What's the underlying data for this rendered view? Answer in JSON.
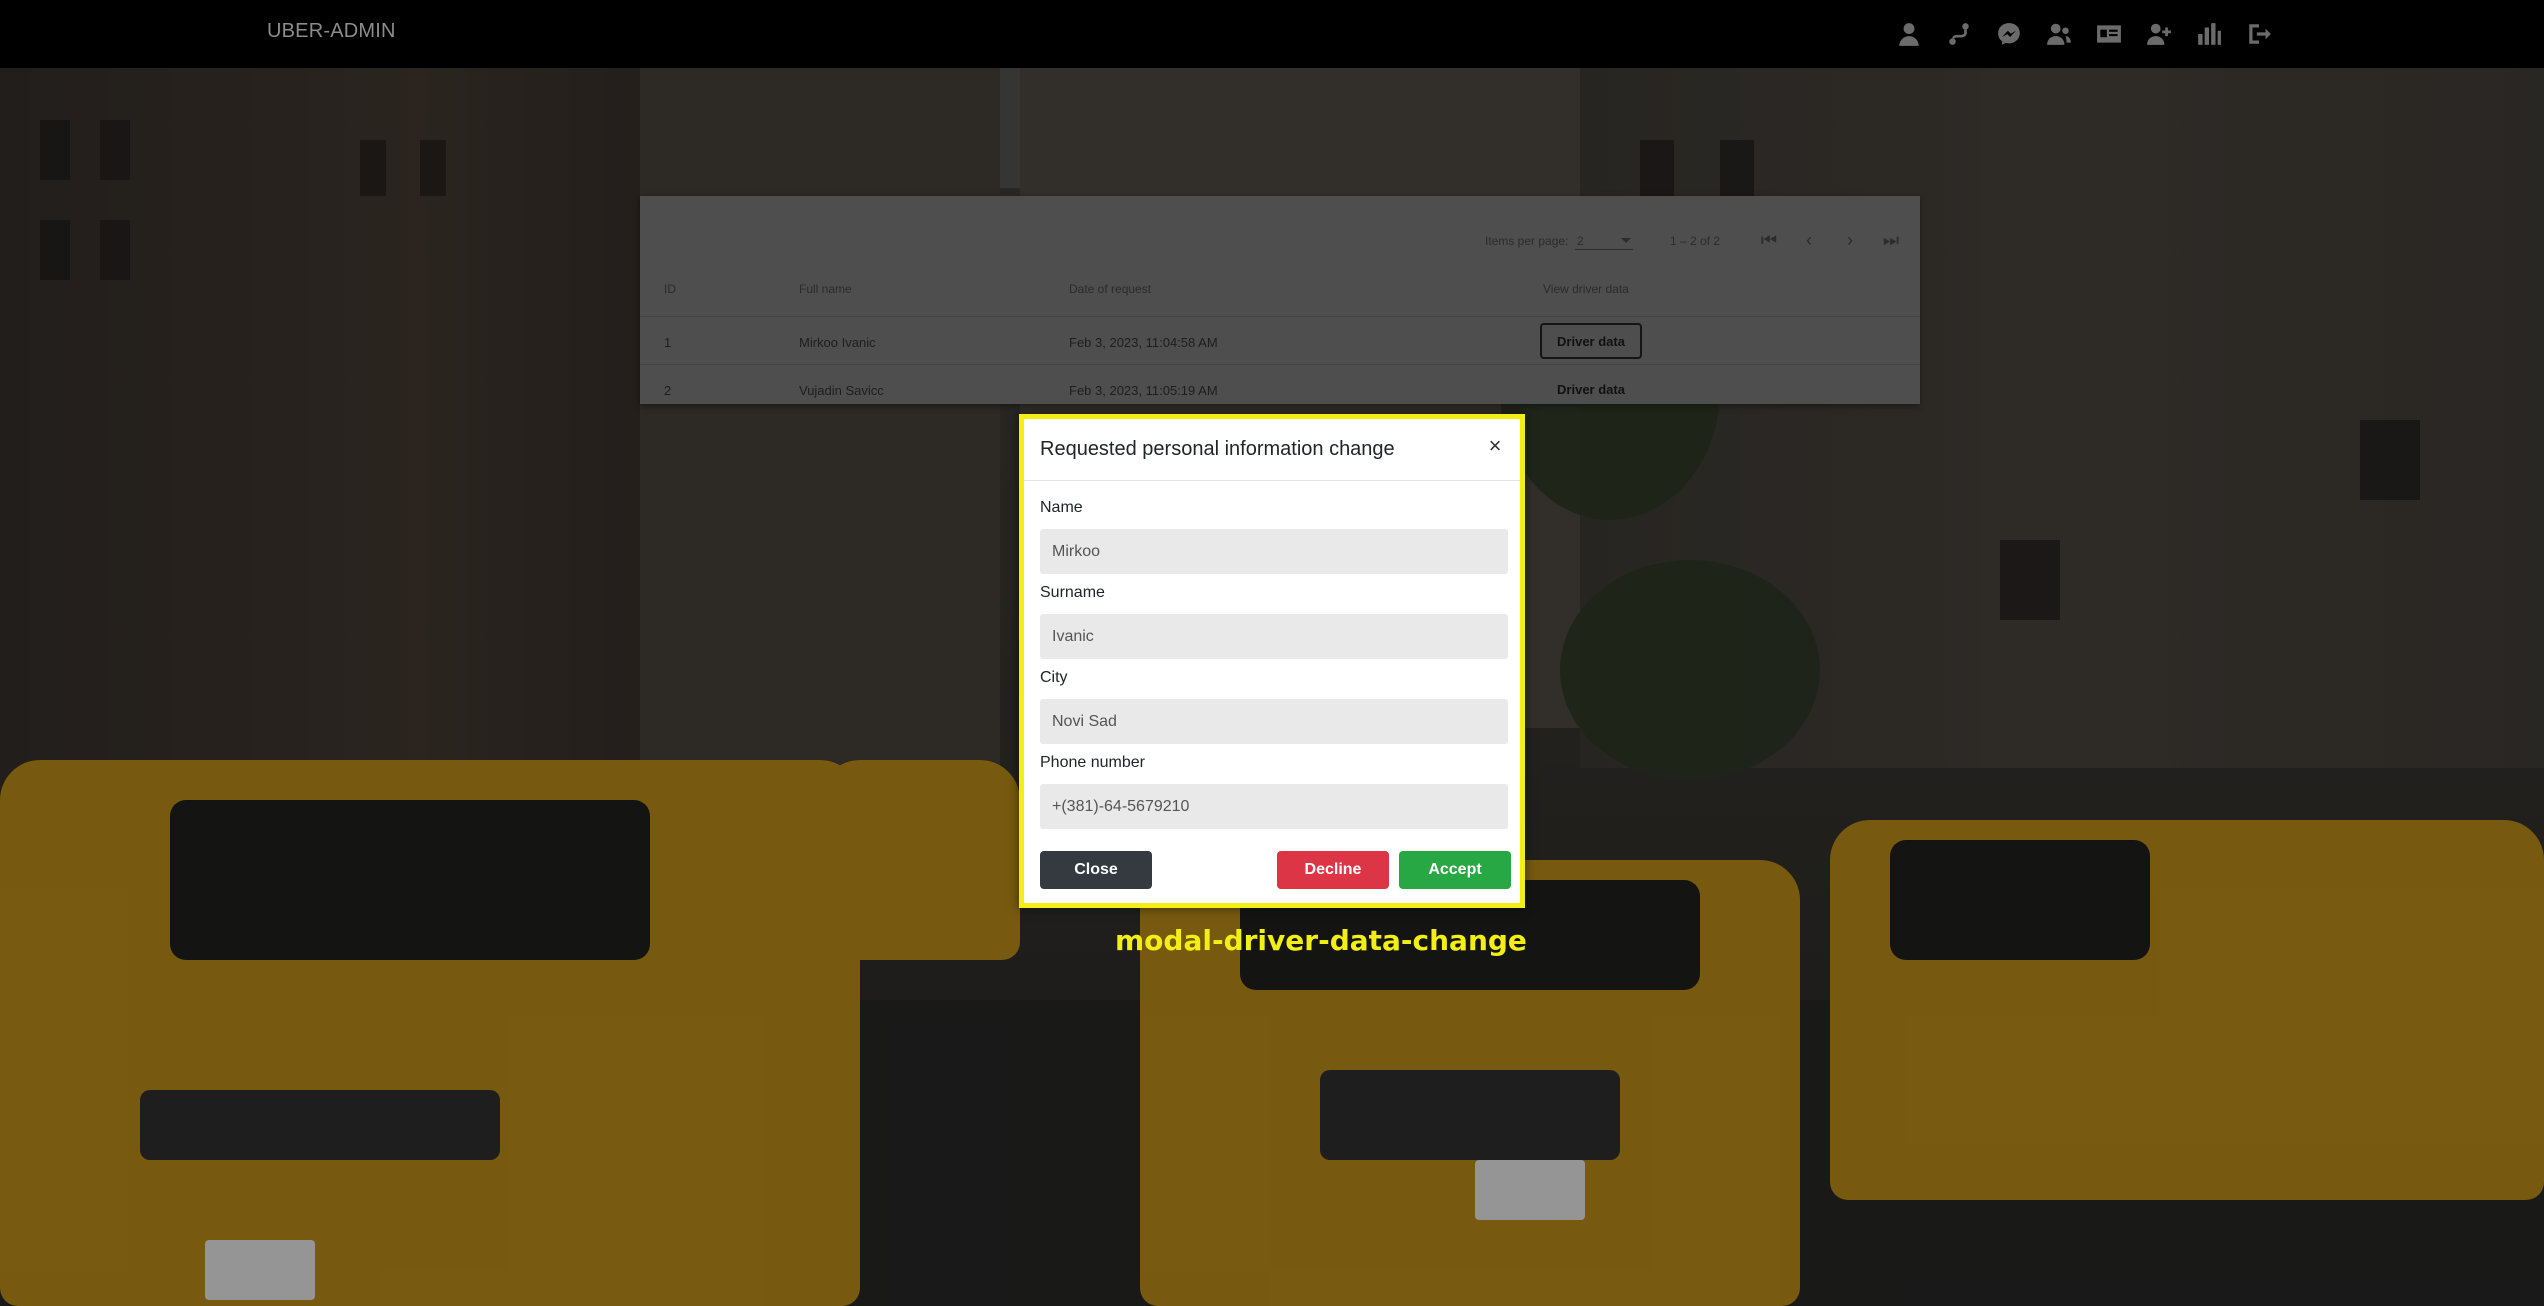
{
  "navbar": {
    "brand": "UBER-ADMIN",
    "icons": [
      "user-icon",
      "driver-route-icon",
      "messenger-icon",
      "users-icon",
      "id-card-icon",
      "add-user-icon",
      "bar-chart-icon",
      "logout-icon"
    ]
  },
  "paginator": {
    "items_per_page_label": "Items per page:",
    "items_per_page_value": "2",
    "range_label": "1 – 2 of 2"
  },
  "table": {
    "headers": [
      "ID",
      "Full name",
      "Date of request",
      "View driver data"
    ],
    "rows": [
      {
        "id": "1",
        "full_name": "Mirkoo Ivanic",
        "date": "Feb 3, 2023, 11:04:58 AM",
        "action": "Driver data"
      },
      {
        "id": "2",
        "full_name": "Vujadin Savicc",
        "date": "Feb 3, 2023, 11:05:19 AM",
        "action": "Driver data"
      }
    ]
  },
  "modal": {
    "title": "Requested personal information change",
    "close_glyph": "×",
    "fields": [
      {
        "label": "Name",
        "value": "Mirkoo"
      },
      {
        "label": "Surname",
        "value": "Ivanic"
      },
      {
        "label": "City",
        "value": "Novi Sad"
      },
      {
        "label": "Phone number",
        "value": "+(381)-64-5679210"
      }
    ],
    "buttons": {
      "close": "Close",
      "decline": "Decline",
      "accept": "Accept"
    },
    "caption": "modal-driver-data-change"
  },
  "colors": {
    "highlight": "#f3ef15",
    "decline": "#dc3545",
    "accept": "#28a745",
    "close": "#343a40"
  }
}
